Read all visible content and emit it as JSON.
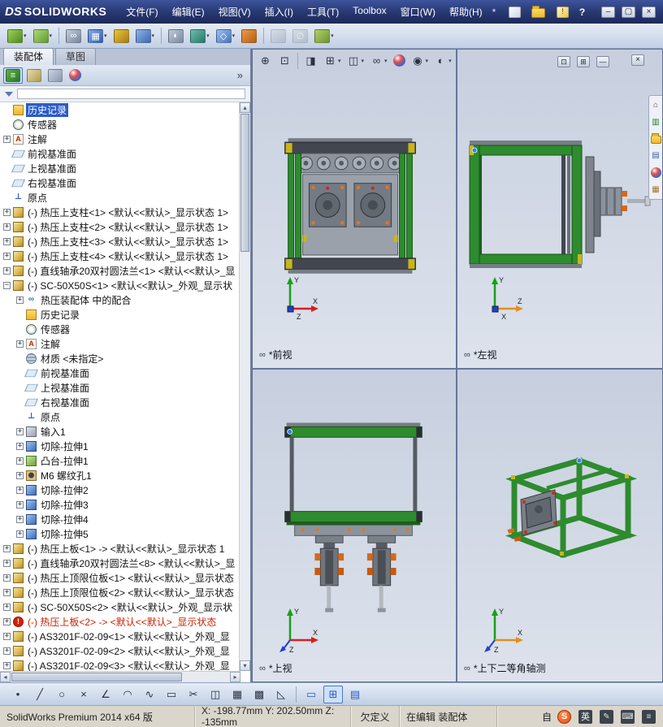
{
  "window": {
    "brand_prefix": "DS",
    "brand": "SOLIDWORKS",
    "menus": [
      "文件(F)",
      "编辑(E)",
      "视图(V)",
      "插入(I)",
      "工具(T)",
      "Toolbox",
      "窗口(W)",
      "帮助(H)"
    ],
    "pin_glyph": "*",
    "quick_icons": [
      {
        "name": "new-document-button",
        "c1": "#ffffff",
        "c2": "#cdd6e4",
        "caret": true
      },
      {
        "name": "open-document-button",
        "folder": true,
        "caret": true
      },
      {
        "name": "print-alert-icon",
        "c1": "#fff8d8",
        "c2": "#e8c840",
        "glyph": "!",
        "color": "#a04000"
      },
      {
        "name": "help-button",
        "glyph": "?"
      }
    ],
    "window_buttons": [
      {
        "name": "minimize-button",
        "glyph": "–"
      },
      {
        "name": "maximize-button",
        "glyph": "▢"
      },
      {
        "name": "close-button",
        "glyph": "×"
      }
    ]
  },
  "toolbar": {
    "items": [
      {
        "name": "insert-components-button",
        "c1": "#9ccf5a",
        "c2": "#4f8a1f",
        "caret": true
      },
      {
        "name": "edit-component-button",
        "c1": "#aed97a",
        "c2": "#5f9a2f",
        "caret": true
      },
      {
        "sep": true
      },
      {
        "name": "mate-button",
        "c1": "#c4cedd",
        "c2": "#75869f",
        "glyph": "∞"
      },
      {
        "name": "linear-component-pattern-button",
        "c1": "#86a9e4",
        "c2": "#2f5fb4",
        "glyph": "▦",
        "caret": true
      },
      {
        "name": "smart-fasteners-button",
        "c1": "#ecc53a",
        "c2": "#a57d14"
      },
      {
        "name": "move-component-button",
        "c1": "#93b2e2",
        "c2": "#3a6ab8",
        "caret": true
      },
      {
        "sep": true
      },
      {
        "name": "show-hidden-components-button",
        "c1": "#bcc8da",
        "c2": "#7a8aa0",
        "glyph": "◐"
      },
      {
        "name": "assembly-features-button",
        "c1": "#6fbcac",
        "c2": "#257a6a",
        "caret": true
      },
      {
        "name": "reference-geometry-button",
        "c1": "#9cc0ec",
        "c2": "#4474c4",
        "glyph": "◇",
        "caret": true
      },
      {
        "name": "new-motion-study-button",
        "c1": "#eb9a4a",
        "c2": "#b55f12"
      },
      {
        "sep": true
      },
      {
        "name": "interference-detection-button",
        "c1": "#ccd2dc",
        "c2": "#97a1b0",
        "disabled": true
      },
      {
        "name": "measure-button",
        "c1": "#ccd2dc",
        "c2": "#97a1b0",
        "glyph": "∅",
        "disabled": true
      },
      {
        "name": "exploded-view-button",
        "c1": "#b3d06a",
        "c2": "#6f9430",
        "caret": true
      }
    ]
  },
  "tabs": [
    "装配体",
    "草图"
  ],
  "panel": {
    "header_icons": [
      {
        "name": "featuremanager-tab",
        "c1": "#5fae4f",
        "c2": "#2a7a1f",
        "glyph": "≡",
        "active": true
      },
      {
        "name": "propertymanager-tab",
        "c1": "#e7dcae",
        "c2": "#b09a50"
      },
      {
        "name": "configurationmanager-tab",
        "c1": "#ccd4e2",
        "c2": "#8b98b0"
      },
      {
        "name": "displaymanager-tab",
        "sphere": true
      }
    ],
    "chevron": "»"
  },
  "tree": {
    "items": [
      {
        "ind": 0,
        "exp": "",
        "icon": "history",
        "label": "历史记录",
        "sel": true
      },
      {
        "ind": 0,
        "exp": "",
        "icon": "sensor",
        "label": "传感器"
      },
      {
        "ind": 0,
        "exp": "+",
        "icon": "annot",
        "label": "注解"
      },
      {
        "ind": 0,
        "exp": "",
        "icon": "plane",
        "label": "前视基准面"
      },
      {
        "ind": 0,
        "exp": "",
        "icon": "plane",
        "label": "上视基准面"
      },
      {
        "ind": 0,
        "exp": "",
        "icon": "plane",
        "label": "右视基准面"
      },
      {
        "ind": 0,
        "exp": "",
        "icon": "origin",
        "label": "原点"
      },
      {
        "ind": 0,
        "exp": "+",
        "icon": "part",
        "label": "(-) 热压上支柱<1> <默认<<默认>_显示状态 1>"
      },
      {
        "ind": 0,
        "exp": "+",
        "icon": "part",
        "label": "(-) 热压上支柱<2> <默认<<默认>_显示状态 1>"
      },
      {
        "ind": 0,
        "exp": "+",
        "icon": "part",
        "label": "(-) 热压上支柱<3> <默认<<默认>_显示状态 1>"
      },
      {
        "ind": 0,
        "exp": "+",
        "icon": "part",
        "label": "(-) 热压上支柱<4> <默认<<默认>_显示状态 1>"
      },
      {
        "ind": 0,
        "exp": "+",
        "icon": "part",
        "label": "(-) 直线轴承20双衬圆法兰<1> <默认<<默认>_显"
      },
      {
        "ind": 0,
        "exp": "-",
        "icon": "part",
        "label": "(-) SC-50X50S<1> <默认<<默认>_外观_显示状"
      },
      {
        "ind": 1,
        "exp": "+",
        "icon": "mates",
        "label": "热压装配体 中的配合"
      },
      {
        "ind": 1,
        "exp": "",
        "icon": "history",
        "label": "历史记录"
      },
      {
        "ind": 1,
        "exp": "",
        "icon": "sensor",
        "label": "传感器"
      },
      {
        "ind": 1,
        "exp": "+",
        "icon": "annot",
        "label": "注解"
      },
      {
        "ind": 1,
        "exp": "",
        "icon": "material",
        "label": "材质 <未指定>"
      },
      {
        "ind": 1,
        "exp": "",
        "icon": "plane",
        "label": "前视基准面"
      },
      {
        "ind": 1,
        "exp": "",
        "icon": "plane",
        "label": "上视基准面"
      },
      {
        "ind": 1,
        "exp": "",
        "icon": "plane",
        "label": "右视基准面"
      },
      {
        "ind": 1,
        "exp": "",
        "icon": "origin",
        "label": "原点"
      },
      {
        "ind": 1,
        "exp": "+",
        "icon": "imported",
        "label": "输入1"
      },
      {
        "ind": 1,
        "exp": "+",
        "icon": "cut",
        "label": "切除-拉伸1"
      },
      {
        "ind": 1,
        "exp": "+",
        "icon": "boss",
        "label": "凸台-拉伸1"
      },
      {
        "ind": 1,
        "exp": "+",
        "icon": "hole",
        "label": "M6 螺纹孔1"
      },
      {
        "ind": 1,
        "exp": "+",
        "icon": "cut",
        "label": "切除-拉伸2"
      },
      {
        "ind": 1,
        "exp": "+",
        "icon": "cut",
        "label": "切除-拉伸3"
      },
      {
        "ind": 1,
        "exp": "+",
        "icon": "cut",
        "label": "切除-拉伸4"
      },
      {
        "ind": 1,
        "exp": "+",
        "icon": "cut",
        "label": "切除-拉伸5"
      },
      {
        "ind": 0,
        "exp": "+",
        "icon": "part",
        "label": "(-) 热压上板<1> -> <默认<<默认>_显示状态 1"
      },
      {
        "ind": 0,
        "exp": "+",
        "icon": "part",
        "label": "(-) 直线轴承20双衬圆法兰<8> <默认<<默认>_显"
      },
      {
        "ind": 0,
        "exp": "+",
        "icon": "part",
        "label": "(-) 热压上顶限位板<1> <默认<<默认>_显示状态"
      },
      {
        "ind": 0,
        "exp": "+",
        "icon": "part",
        "label": "(-) 热压上顶限位板<2> <默认<<默认>_显示状态"
      },
      {
        "ind": 0,
        "exp": "+",
        "icon": "part",
        "label": "(-) SC-50X50S<2> <默认<<默认>_外观_显示状"
      },
      {
        "ind": 0,
        "exp": "+",
        "icon": "part-err",
        "label": "(-) 热压上板<2> -> <默认<<默认>_显示状态",
        "red": true
      },
      {
        "ind": 0,
        "exp": "+",
        "icon": "part",
        "label": "(-) AS3201F-02-09<1> <默认<<默认>_外观_显"
      },
      {
        "ind": 0,
        "exp": "+",
        "icon": "part",
        "label": "(-) AS3201F-02-09<2> <默认<<默认>_外观_显"
      },
      {
        "ind": 0,
        "exp": "+",
        "icon": "part",
        "label": "(-) AS3201F-02-09<3> <默认<<默认>_外观_显"
      }
    ]
  },
  "headsup": {
    "items": [
      {
        "name": "zoom-fit-button",
        "glyph": "⊕"
      },
      {
        "name": "zoom-area-button",
        "glyph": "⊡"
      },
      {
        "sep": true
      },
      {
        "name": "section-view-button",
        "glyph": "◨"
      },
      {
        "name": "view-orientation-button",
        "glyph": "⊞",
        "caret": true
      },
      {
        "name": "display-style-button",
        "glyph": "◫",
        "caret": true
      },
      {
        "name": "hide-show-items-button",
        "glyph": "∞",
        "caret": true
      },
      {
        "name": "edit-appearance-button",
        "sphere": true
      },
      {
        "name": "apply-scene-button",
        "glyph": "◉",
        "caret": true
      },
      {
        "name": "view-settings-button",
        "glyph": "◐",
        "caret": true
      }
    ],
    "window_controls": [
      {
        "name": "viewport-restore-button",
        "glyph": "⊡"
      },
      {
        "name": "viewport-split-button",
        "glyph": "⊞"
      },
      {
        "name": "viewport-minimize-button",
        "glyph": "—"
      }
    ],
    "close_glyph": "×"
  },
  "taskpane": {
    "items": [
      {
        "name": "task-pane-home-tab",
        "glyph": "⌂",
        "color": "#7a4a1a"
      },
      {
        "name": "design-library-tab",
        "glyph": "▥",
        "color": "#2a7a2a"
      },
      {
        "name": "file-explorer-tab",
        "folder": true
      },
      {
        "name": "view-palette-tab",
        "glyph": "▤",
        "color": "#3a62a8"
      },
      {
        "name": "appearances-tab",
        "sphere": true
      },
      {
        "name": "custom-properties-tab",
        "glyph": "▦",
        "color": "#a8762a"
      }
    ]
  },
  "graphics": {
    "label_icon": "∞",
    "frame_green": "#2e8b2e",
    "viewport_bg": "#ccd3e2"
  },
  "viewports": [
    {
      "label": "*前视",
      "triad": [
        {
          "label": "Y",
          "color": "#18a018"
        },
        {
          "label": "X",
          "color": "#d42020"
        },
        {
          "label": "Z",
          "color": "#2040d0",
          "diag": false
        }
      ]
    },
    {
      "label": "*左视",
      "triad": [
        {
          "label": "Y",
          "color": "#18a018"
        },
        {
          "label": "Z",
          "color": "#e09020"
        },
        {
          "label": "X",
          "color": "#2040d0",
          "diag": false
        }
      ]
    },
    {
      "label": "*上视",
      "triad": [
        {
          "label": "Y",
          "color": "#18a018"
        },
        {
          "label": "X",
          "color": "#d42020"
        },
        {
          "label": "Z",
          "color": "#2040d0",
          "diag": true
        }
      ]
    },
    {
      "label": "*上下二等角轴测",
      "triad": [
        {
          "label": "Y",
          "color": "#18a018"
        },
        {
          "label": "X",
          "color": "#e09020"
        },
        {
          "label": "Z",
          "color": "#2040d0",
          "diag": true
        }
      ]
    }
  ],
  "bottombar": {
    "items": [
      {
        "name": "sketch-point-button",
        "glyph": "•"
      },
      {
        "name": "sketch-line-button",
        "glyph": "╱"
      },
      {
        "name": "sketch-circle-button",
        "glyph": "○"
      },
      {
        "name": "sketch-erase-button",
        "glyph": "×"
      },
      {
        "name": "sketch-angle-button",
        "glyph": "∠"
      },
      {
        "name": "sketch-arc-button",
        "glyph": "◠"
      },
      {
        "name": "sketch-spline-button",
        "glyph": "∿"
      },
      {
        "name": "sketch-rectangle-button",
        "glyph": "▭"
      },
      {
        "name": "sketch-trim-button",
        "glyph": "✂"
      },
      {
        "name": "sketch-mirror-button",
        "glyph": "◫"
      },
      {
        "name": "linear-sketch-pattern-button",
        "glyph": "▦"
      },
      {
        "name": "sketch-grid-button",
        "glyph": "▩"
      },
      {
        "name": "convert-entities-button",
        "glyph": "◺"
      },
      {
        "sep": true
      },
      {
        "name": "viewport-single-view-button",
        "glyph": "▭",
        "color": "#2a5cc8"
      },
      {
        "name": "viewport-four-view-button",
        "glyph": "⊞",
        "color": "#2a5cc8",
        "active": true
      },
      {
        "name": "viewport-two-view-button",
        "glyph": "▤",
        "color": "#2a5cc8"
      }
    ]
  },
  "statusbar": {
    "version": "SolidWorks Premium 2014 x64 版",
    "coordinates": "X: -198.77mm Y: 202.50mm Z: -135mm",
    "definition_state": "欠定义",
    "editing_state": "在编辑 装配体",
    "custom_label": "自",
    "lang_items": [
      {
        "name": "sogou-input-icon",
        "badge": "S"
      },
      {
        "name": "language-indicator",
        "box": "英"
      },
      {
        "name": "ime-pen-button",
        "glyph": "✎"
      },
      {
        "name": "ime-keyboard-button",
        "glyph": "⌨"
      },
      {
        "name": "ime-menu-button",
        "glyph": "≡"
      }
    ]
  }
}
